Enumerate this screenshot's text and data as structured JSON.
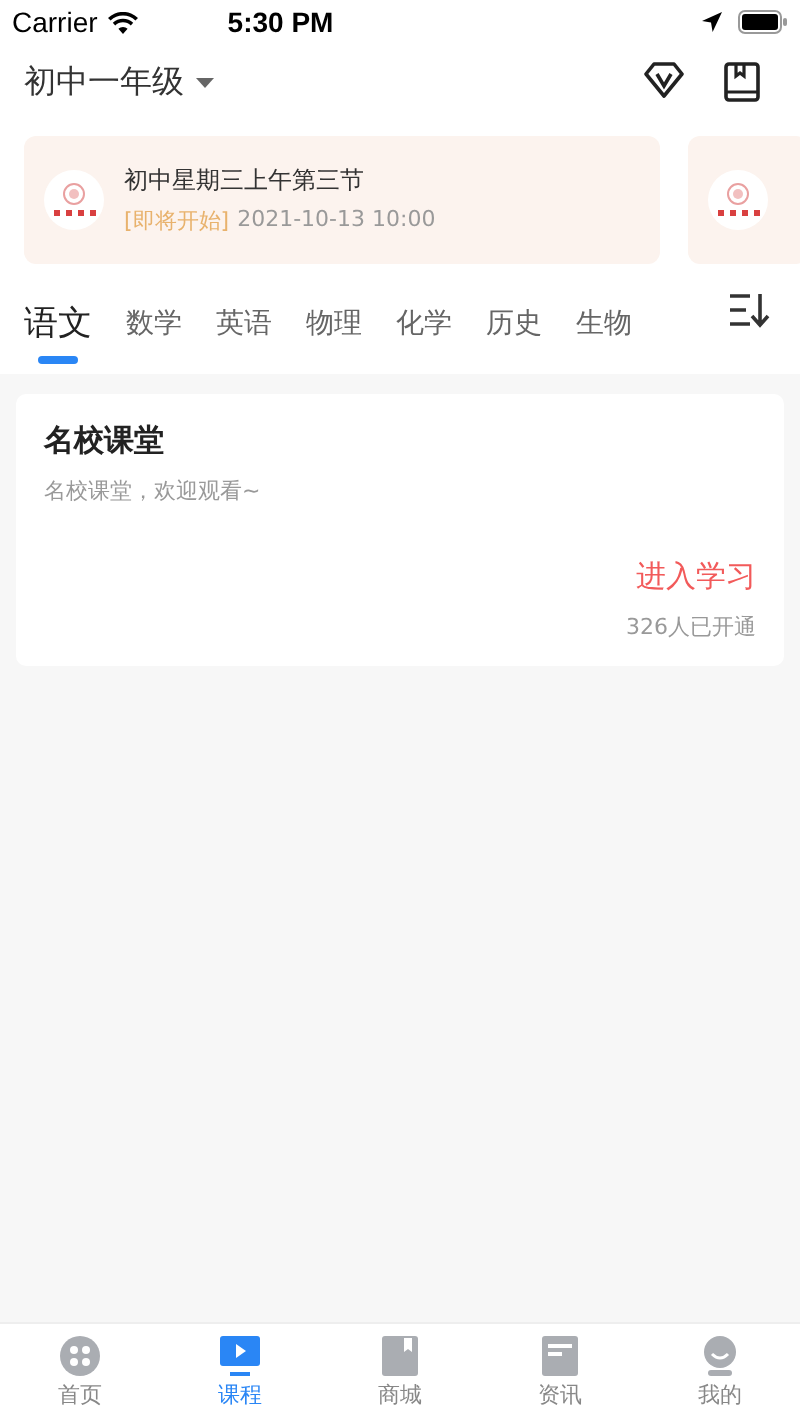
{
  "status_bar": {
    "carrier": "Carrier",
    "time": "5:30 PM"
  },
  "header": {
    "grade": "初中一年级"
  },
  "live_cards": [
    {
      "title": "初中星期三上午第三节",
      "status": "[即将开始]",
      "time": "2021-10-13 10:00"
    },
    {
      "kind": "partial"
    }
  ],
  "subject_tabs": [
    {
      "label": "语文",
      "selected": true
    },
    {
      "label": "数学",
      "selected": false
    },
    {
      "label": "英语",
      "selected": false
    },
    {
      "label": "物理",
      "selected": false
    },
    {
      "label": "化学",
      "selected": false
    },
    {
      "label": "历史",
      "selected": false
    },
    {
      "label": "生物",
      "selected": false
    }
  ],
  "course_card": {
    "title": "名校课堂",
    "subtitle": "名校课堂，欢迎观看~",
    "action": "进入学习",
    "count": "326人已开通"
  },
  "tab_bar": [
    {
      "label": "首页",
      "selected": false
    },
    {
      "label": "课程",
      "selected": true
    },
    {
      "label": "商城",
      "selected": false
    },
    {
      "label": "资讯",
      "selected": false
    },
    {
      "label": "我的",
      "selected": false
    }
  ]
}
